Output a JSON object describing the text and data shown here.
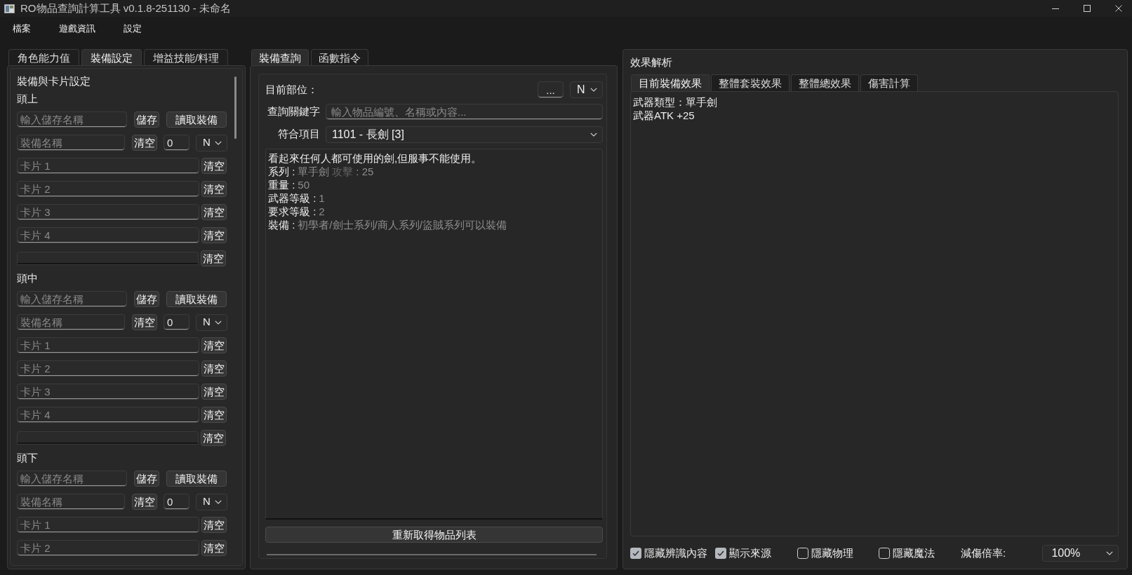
{
  "window": {
    "title": "RO物品查詢計算工具 v0.1.8-251130 - 未命名"
  },
  "menu": [
    {
      "label": "檔案"
    },
    {
      "label": "遊戲資訊"
    },
    {
      "label": "設定"
    }
  ],
  "equipment_panel": {
    "tabs": [
      {
        "label": "角色能力值",
        "selected": false
      },
      {
        "label": "裝備設定",
        "selected": true
      },
      {
        "label": "增益技能/料理",
        "selected": false
      }
    ],
    "title": "裝備與卡片設定",
    "slots": [
      {
        "label": "頭上",
        "save_name": {
          "placeholder": "輸入儲存名稱"
        },
        "save_button": "儲存",
        "load_button": "讀取裝備",
        "equipment": {
          "placeholder": "裝備名稱"
        },
        "equipment_clear": "清空",
        "refine": {
          "value": "0"
        },
        "grade": {
          "value": "N"
        },
        "cards": [
          {
            "placeholder": "卡片 1",
            "clear_button": "清空"
          },
          {
            "placeholder": "卡片 2",
            "clear_button": "清空"
          },
          {
            "placeholder": "卡片 3",
            "clear_button": "清空"
          },
          {
            "placeholder": "卡片 4",
            "clear_button": "清空"
          }
        ],
        "custom_effect": {
          "clear_button": "清空"
        }
      },
      {
        "label": "頭中",
        "save_name": {
          "placeholder": "輸入儲存名稱"
        },
        "save_button": "儲存",
        "load_button": "讀取裝備",
        "equipment": {
          "placeholder": "裝備名稱"
        },
        "equipment_clear": "清空",
        "refine": {
          "value": "0"
        },
        "grade": {
          "value": "N"
        },
        "cards": [
          {
            "placeholder": "卡片 1",
            "clear_button": "清空"
          },
          {
            "placeholder": "卡片 2",
            "clear_button": "清空"
          },
          {
            "placeholder": "卡片 3",
            "clear_button": "清空"
          },
          {
            "placeholder": "卡片 4",
            "clear_button": "清空"
          }
        ],
        "custom_effect": {
          "clear_button": "清空"
        }
      },
      {
        "label": "頭下",
        "save_name": {
          "placeholder": "輸入儲存名稱"
        },
        "save_button": "儲存",
        "load_button": "讀取裝備",
        "equipment": {
          "placeholder": "裝備名稱"
        },
        "equipment_clear": "清空",
        "refine": {
          "value": "0"
        },
        "grade": {
          "value": "N"
        },
        "cards": [
          {
            "placeholder": "卡片 1",
            "clear_button": "清空"
          },
          {
            "placeholder": "卡片 2",
            "clear_button": "清空"
          }
        ]
      }
    ]
  },
  "query_panel": {
    "tabs": [
      {
        "label": "裝備查詢",
        "selected": true
      },
      {
        "label": "函數指令",
        "selected": false
      }
    ],
    "slot_label": "目前部位：",
    "slot_field": {
      "value": "..."
    },
    "grade": {
      "value": "N"
    },
    "keyword": {
      "label": "查詢關鍵字",
      "placeholder": "輸入物品編號、名稱或內容..."
    },
    "match": {
      "label": "符合項目",
      "value": "1101 - 長劍 [3]"
    },
    "description": [
      [
        {
          "text": "看起來任何人都可使用的劍,但服事不能使用。",
          "kind": "label"
        }
      ],
      [
        {
          "text": "系列 :",
          "kind": "label"
        },
        {
          "text": "單手劍",
          "kind": "value"
        },
        {
          "text": "攻擊",
          "kind": "dark"
        },
        {
          "text": ": 25",
          "kind": "value"
        }
      ],
      [
        {
          "text": "重量 :",
          "kind": "label"
        },
        {
          "text": "50",
          "kind": "value"
        }
      ],
      [
        {
          "text": "武器等級 :",
          "kind": "label"
        },
        {
          "text": "1",
          "kind": "value"
        }
      ],
      [
        {
          "text": "要求等級 :",
          "kind": "label"
        },
        {
          "text": "2",
          "kind": "value"
        }
      ],
      [
        {
          "text": "裝備 :",
          "kind": "label"
        },
        {
          "text": "初學者/劍士系列/商人系列/盜賊系列可以裝備",
          "kind": "value"
        }
      ]
    ],
    "refresh_button": "重新取得物品列表"
  },
  "effects_panel": {
    "title": "效果解析",
    "tabs": [
      {
        "label": "目前裝備效果",
        "selected": true
      },
      {
        "label": "整體套裝效果",
        "selected": false
      },
      {
        "label": "整體總效果",
        "selected": false
      },
      {
        "label": "傷害計算",
        "selected": false
      }
    ],
    "lines": [
      "武器類型：單手劍",
      "武器ATK +25"
    ],
    "options": [
      {
        "label": "隱藏辨識內容",
        "checked": true
      },
      {
        "label": "顯示來源",
        "checked": true
      },
      {
        "label": "隱藏物理",
        "checked": false
      },
      {
        "label": "隱藏魔法",
        "checked": false
      }
    ],
    "damage_rate": {
      "label": "減傷倍率:",
      "value": "100%"
    }
  }
}
